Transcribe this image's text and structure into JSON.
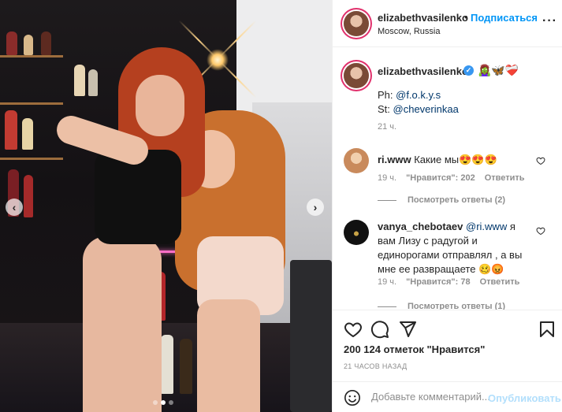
{
  "post": {
    "username": "elizabethvasilenko",
    "separator": "•",
    "follow_label": "Подписаться",
    "location": "Moscow, Russia",
    "more_icon": "more-horizontal-icon",
    "carousel": {
      "slides": 3,
      "active": 1
    }
  },
  "caption": {
    "username": "elizabethvasilenko",
    "verified": "✓",
    "emoji": "🧟‍♀️🦋❤️‍🩹",
    "ph_label": "Ph: ",
    "ph_mention": "@f.o.k.y.s",
    "st_label": "St: ",
    "st_mention": "@cheverinkaa",
    "time": "21 ч."
  },
  "comments": [
    {
      "username": "ri.www",
      "text": " Какие мы😍😍😍",
      "time": "19 ч.",
      "likes": "\"Нравится\": 202",
      "reply": "Ответить",
      "view_replies": "Посмотреть ответы (2)"
    },
    {
      "username": "vanya_chebotaev",
      "mention": " @ri.www",
      "text": " я вам Лизу с радугой и единорогами отправлял , а вы мне ее развращаете 🥴😡",
      "time": "19 ч.",
      "likes": "\"Нравится\": 78",
      "reply": "Ответить",
      "view_replies": "Посмотреть ответы (1)"
    }
  ],
  "actions": {
    "likes": "200 124 отметок \"Нравится\"",
    "posted_ago": "21 ЧАСОВ НАЗАД"
  },
  "add_comment": {
    "placeholder": "Добавьте комментарий...",
    "publish": "Опубликовать"
  },
  "colors": {
    "accent": "#0095f6",
    "publish_disabled": "#b2dffc",
    "story_ring": "#e1306c",
    "verified": "#3897f0",
    "muted": "#8e8e8e"
  }
}
